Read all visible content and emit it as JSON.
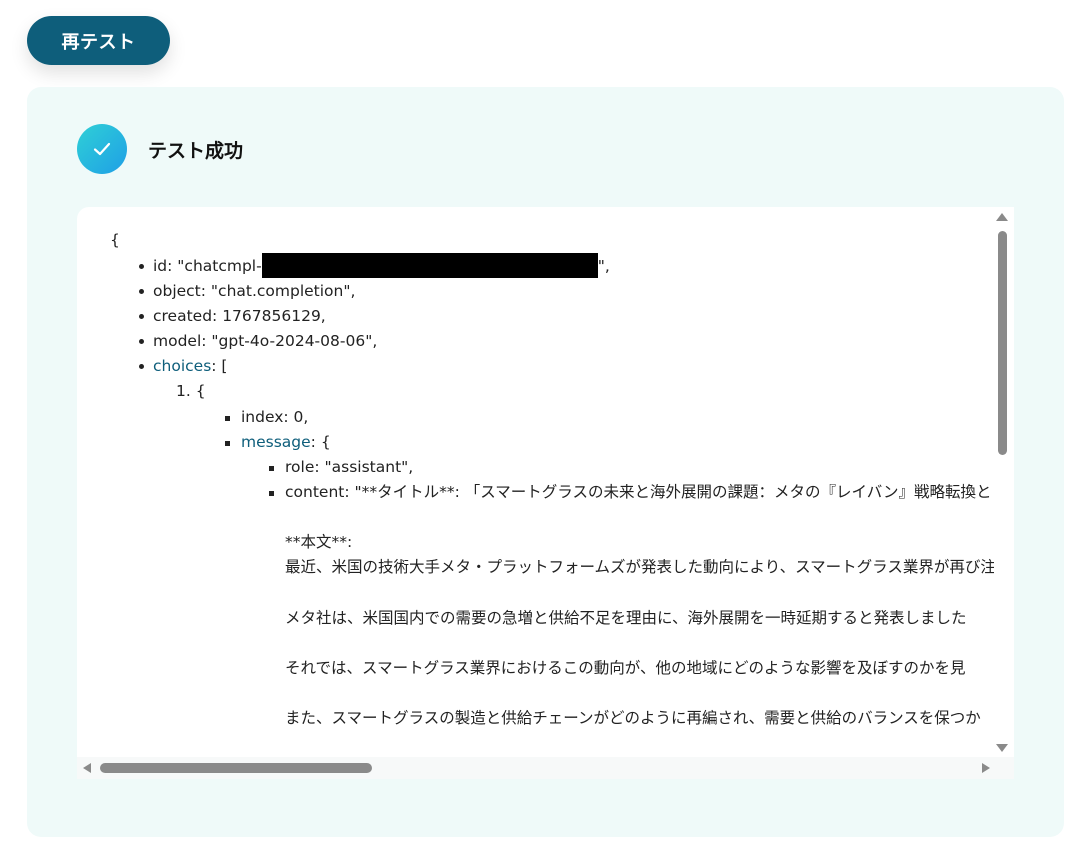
{
  "toolbar": {
    "retest_label": "再テスト"
  },
  "status": {
    "text": "テスト成功",
    "icon": "check-icon"
  },
  "colors": {
    "primary": "#0e5e7b",
    "panel_bg": "#effaf9",
    "success_from": "#2fd0d6",
    "success_to": "#1f9fe6"
  },
  "json_view": {
    "open_brace": "{",
    "id_prefix": "id: \"chatcmpl-",
    "id_suffix": "\",",
    "object": "object: \"chat.completion\",",
    "created": "created: 1767856129,",
    "model": "model: \"gpt-4o-2024-08-06\",",
    "choices_key": "choices",
    "choices_open": ": [",
    "item_index": "1. {",
    "index_line": "index: 0,",
    "message_key": "message",
    "message_open": ": {",
    "role_line": "role: \"assistant\",",
    "content_line": "content: \"**タイトル**: 「スマートグラスの未来と海外展開の課題：メタの『レイバン』戦略転換と",
    "content_body_heading": "**本文**:",
    "content_p1": "最近、米国の技術大手メタ・プラットフォームズが発表した動向により、スマートグラス業界が再び注",
    "content_p2": "メタ社は、米国国内での需要の急増と供給不足を理由に、海外展開を一時延期すると発表しました",
    "content_p3": "それでは、スマートグラス業界におけるこの動向が、他の地域にどのような影響を及ぼすのかを見",
    "content_p4": "また、スマートグラスの製造と供給チェーンがどのように再編され、需要と供給のバランスを保つか"
  }
}
